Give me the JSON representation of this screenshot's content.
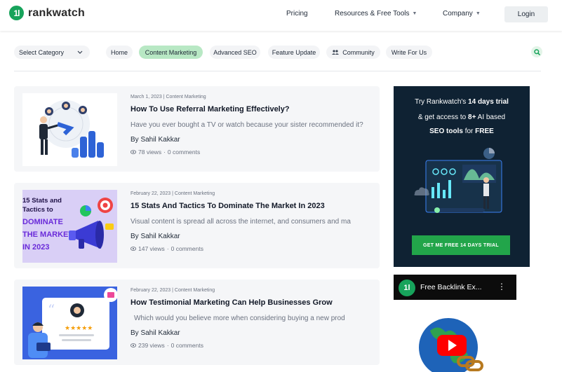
{
  "header": {
    "logo_text": "rankwatch",
    "logo_mark": "1l",
    "nav": [
      {
        "label": "Pricing",
        "has_dropdown": false
      },
      {
        "label": "Resources & Free Tools",
        "has_dropdown": true
      },
      {
        "label": "Company",
        "has_dropdown": true
      }
    ],
    "login_label": "Login"
  },
  "category_bar": {
    "select_label": "Select Category",
    "pills": [
      "Home",
      "Content Marketing",
      "Advanced SEO",
      "Feature Update",
      "Community",
      "Write For Us"
    ],
    "active_pill": "Content Marketing"
  },
  "posts": [
    {
      "date": "March 1, 2023",
      "category": "Content Marketing",
      "title": "How To Use Referral Marketing Effectively?",
      "excerpt": "Have you ever bought a TV or watch because your sister recommended it?",
      "author": "By Sahil Kakkar",
      "views": "78 views",
      "comments": "0 comments"
    },
    {
      "date": "February 22, 2023",
      "category": "Content Marketing",
      "title": "15 Stats And Tactics To Dominate The Market In 2023",
      "excerpt": "Visual content is spread all across the internet, and consumers and ma",
      "author": "By Sahil Kakkar",
      "views": "147 views",
      "comments": "0 comments",
      "thumb_text": [
        "15 Stats and",
        "Tactics to",
        "DOMINATE",
        "THE MARKET",
        "IN 2023"
      ]
    },
    {
      "date": "February 22, 2023",
      "category": "Content Marketing",
      "title": "How Testimonial Marketing Can Help Businesses Grow",
      "excerpt": "Which would you believe more when considering buying a new prod",
      "author": "By Sahil Kakkar",
      "views": "239 views",
      "comments": "0 comments"
    }
  ],
  "sidebar_ad": {
    "line1_a": "Try Rankwatch's ",
    "line1_b": "14 days trial",
    "line2_a": "& get access to ",
    "line2_b": "8+",
    "line2_c": " AI based",
    "line3_a": "SEO tools",
    "line3_b": " for ",
    "line3_c": "FREE",
    "cta": "GET ME FREE 14 DAYS TRIAL"
  },
  "video": {
    "title": "Free Backlink Ex..."
  },
  "colors": {
    "brand_green": "#17a35b",
    "active_pill": "#b8e8c4",
    "ad_bg": "#0f2233",
    "cta_green": "#22a54a"
  },
  "icons": [
    "logo-icon",
    "chevron-down-icon",
    "community-icon",
    "search-icon",
    "eye-icon",
    "youtube-play-icon",
    "more-vertical-icon"
  ]
}
